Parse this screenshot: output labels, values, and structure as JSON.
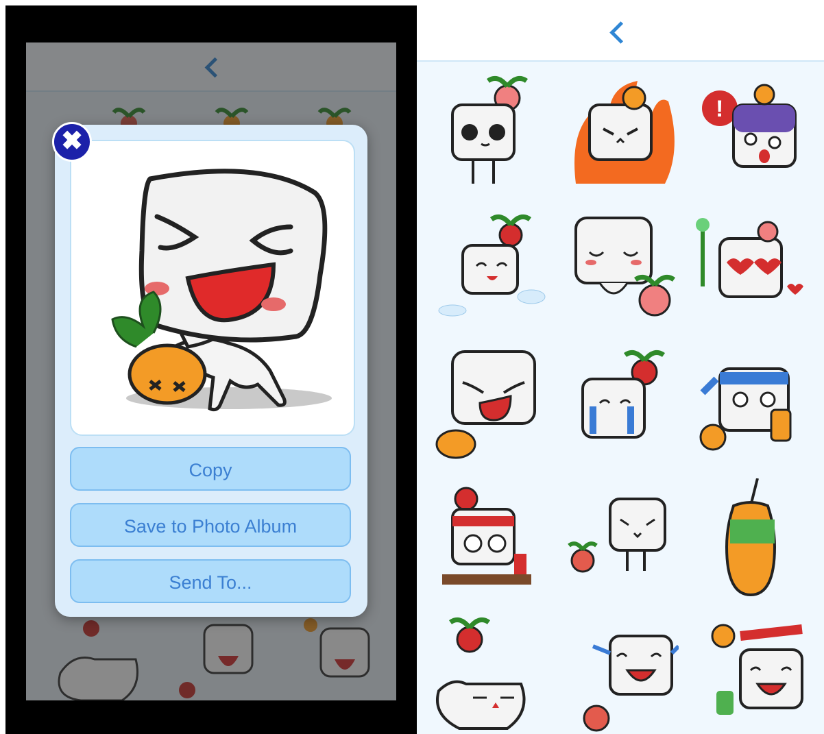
{
  "popup": {
    "close_symbol": "✖",
    "actions": [
      {
        "label": "Copy"
      },
      {
        "label": "Save to Photo Album"
      },
      {
        "label": "Send To..."
      }
    ]
  },
  "icons": {
    "back": "chevron-left-icon",
    "close": "close-icon"
  },
  "colors": {
    "accent": "#2f86d4",
    "button_fill": "#aedcfb",
    "button_text": "#3b7fd2",
    "close_badge": "#1c21a9"
  },
  "sticker_grid": {
    "columns": 3,
    "rows": 5,
    "items": [
      "crying-eyes-sticker",
      "fire-angry-sticker",
      "shocked-purple-sticker",
      "angel-happy-sticker",
      "sleepy-bow-sticker",
      "heart-eyes-sticker",
      "evil-grin-sticker",
      "tearful-sticker",
      "headband-drink-sticker",
      "study-desk-sticker",
      "nervous-sticker",
      "juice-bottle-sticker",
      "lying-down-sticker",
      "laughing-tears-sticker",
      "new-year-sticker"
    ]
  }
}
